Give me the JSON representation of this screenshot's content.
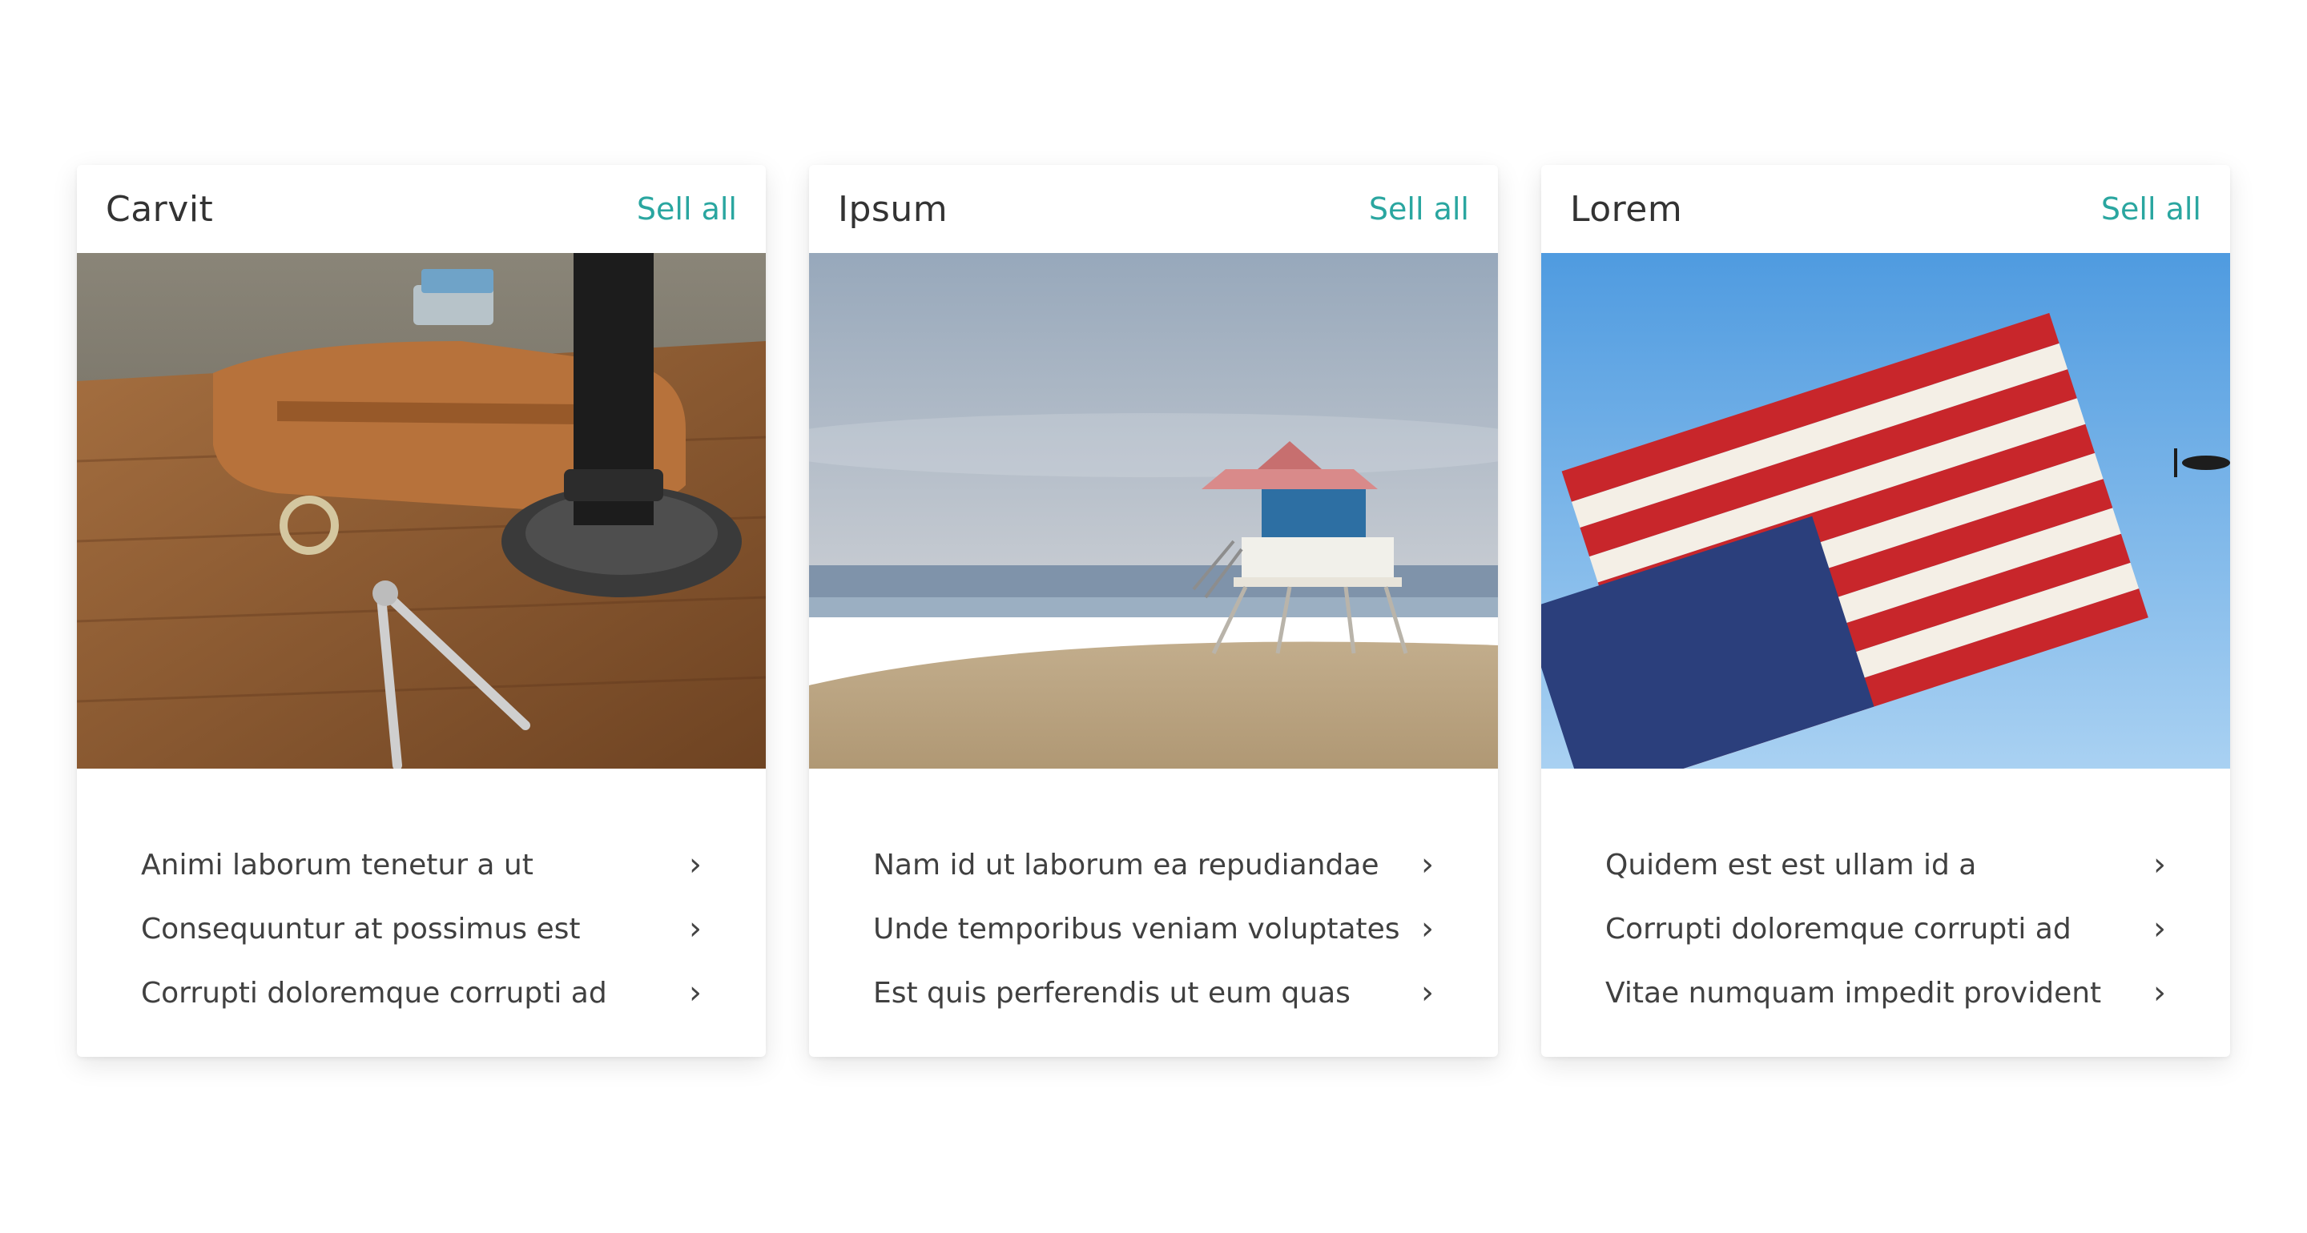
{
  "theme": {
    "accent": "#2aa6a0"
  },
  "cards": [
    {
      "title": "Carvit",
      "see_all": "Sell all",
      "image_name": "leather-notebook-compass-on-desk",
      "items": [
        {
          "label": "Animi laborum tenetur a ut",
          "icon": "chevron-right-icon",
          "glyph": "›"
        },
        {
          "label": "Consequuntur at possimus est",
          "icon": "chevron-right-icon",
          "glyph": "›"
        },
        {
          "label": "Corrupti doloremque corrupti ad",
          "icon": "chevron-right-icon",
          "glyph": "›"
        }
      ]
    },
    {
      "title": "Ipsum",
      "see_all": "Sell all",
      "image_name": "lifeguard-tower-beach",
      "items": [
        {
          "label": "Nam id ut laborum ea repudiandae",
          "icon": "chevron-right-icon",
          "glyph": "›"
        },
        {
          "label": "Unde temporibus veniam voluptates",
          "icon": "chevron-right-icon",
          "glyph": "›"
        },
        {
          "label": "Est quis perferendis ut eum quas",
          "icon": "chevron-right-icon",
          "glyph": "›"
        }
      ]
    },
    {
      "title": "Lorem",
      "see_all": "Sell all",
      "image_name": "american-flag-sky",
      "items": [
        {
          "label": "Quidem est est ullam id a",
          "icon": "chevron-right-icon",
          "glyph": "›"
        },
        {
          "label": "Corrupti doloremque corrupti ad",
          "icon": "chevron-right-icon",
          "glyph": "›"
        },
        {
          "label": "Vitae numquam impedit provident",
          "icon": "chevron-right-icon",
          "glyph": "›"
        }
      ]
    }
  ]
}
